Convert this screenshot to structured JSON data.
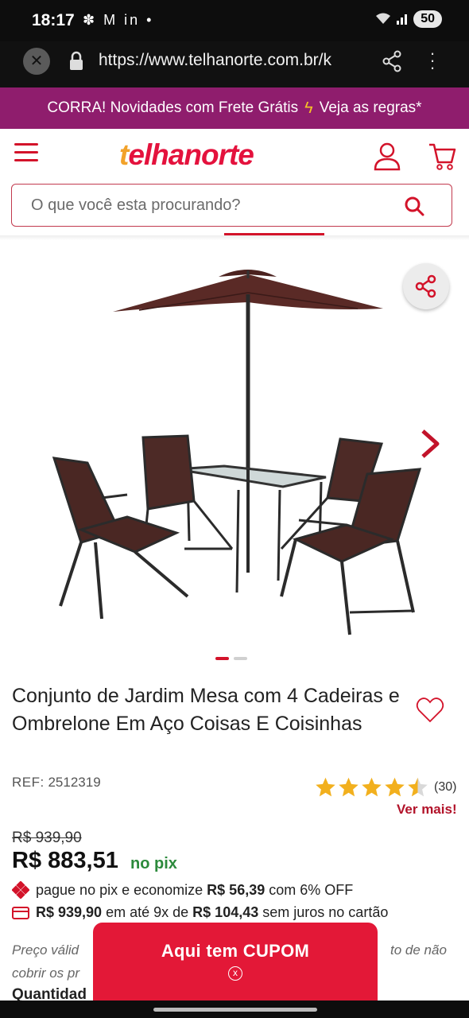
{
  "status_bar": {
    "time": "18:17",
    "notification_icons": "✽ M in •",
    "battery": "50"
  },
  "browser": {
    "url": "https://www.telhanorte.com.br/k",
    "close_icon": "close-icon",
    "lock_icon": "lock-icon",
    "share_icon": "share-icon",
    "menu_icon": "more-vert-icon"
  },
  "promo_banner": {
    "left_text": "CORRA! Novidades com Frete Grátis",
    "right_text": "Veja as regras*",
    "bolt_color": "#f5c326",
    "background": "#8f1d6d"
  },
  "header": {
    "logo_t": "t",
    "logo_rest": "elhanorte",
    "accent_color": "#e4123d"
  },
  "search": {
    "placeholder": "O que você esta procurando?"
  },
  "gallery": {
    "total_images": 2,
    "active_index": 0
  },
  "product": {
    "title": "Conjunto de Jardim Mesa com 4 Cadeiras e Ombrelone Em Aço Coisas E Coisinhas",
    "ref_label": "REF:",
    "ref_value": "2512319",
    "rating": 4.5,
    "rating_count": "(30)",
    "see_more": "Ver mais!",
    "old_price": "R$ 939,90",
    "price": "R$ 883,51",
    "price_suffix": "no pix",
    "pix_text_1": "pague no pix e economize",
    "pix_savings": "R$ 56,39",
    "pix_text_2": "com 6% OFF",
    "card_price": "R$ 939,90",
    "card_text_1": "em até 9x de",
    "card_installment": "R$ 104,43",
    "card_text_2": "sem juros no cartão",
    "note_left": "Preço válid",
    "note_right": "to de não",
    "note_left_2": "cobrir os pr",
    "quantity_label": "Quantidad"
  },
  "coupon": {
    "label": "Aqui tem CUPOM",
    "close": "x"
  }
}
